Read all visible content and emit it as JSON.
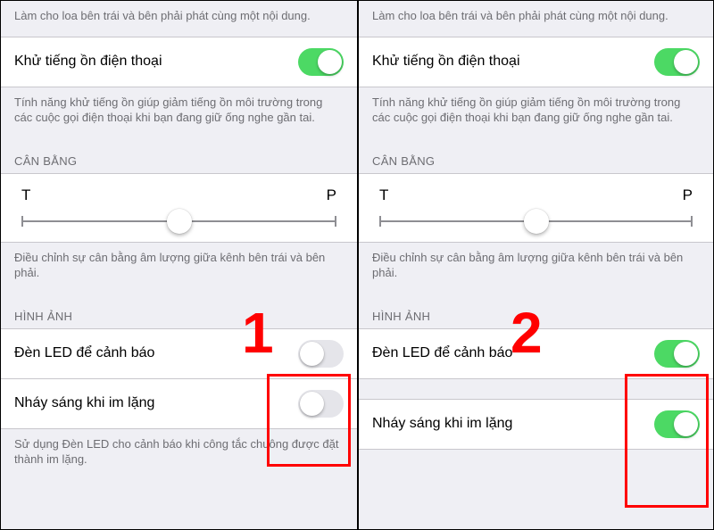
{
  "shared": {
    "speaker_desc": "Làm cho loa bên trái và bên phải phát cùng một nội dung.",
    "noise_cancel_label": "Khử tiếng ồn điện thoại",
    "noise_cancel_desc": "Tính năng khử tiếng ồn giúp giảm tiếng ồn môi trường trong các cuộc gọi điện thoại khi bạn đang giữ ống nghe gần tai.",
    "balance_header": "CÂN BẰNG",
    "balance_left": "T",
    "balance_right": "P",
    "balance_desc": "Điều chỉnh sự cân bằng âm lượng giữa kênh bên trái và bên phải.",
    "visual_header": "HÌNH ẢNH",
    "led_label": "Đèn LED để cảnh báo",
    "flash_silent_label": "Nháy sáng khi im lặng",
    "led_footer": "Sử dụng Đèn LED cho cảnh báo khi công tắc chuông được đặt thành im lặng."
  },
  "balance_value": 0.5,
  "panel1": {
    "annotation": "1",
    "noise_cancel_on": true,
    "led_on": false,
    "flash_silent_on": false
  },
  "panel2": {
    "annotation": "2",
    "noise_cancel_on": true,
    "led_on": true,
    "flash_silent_on": true
  },
  "colors": {
    "toggle_on": "#4cd964",
    "annotation_red": "#ff0000",
    "bg": "#efeff4"
  }
}
